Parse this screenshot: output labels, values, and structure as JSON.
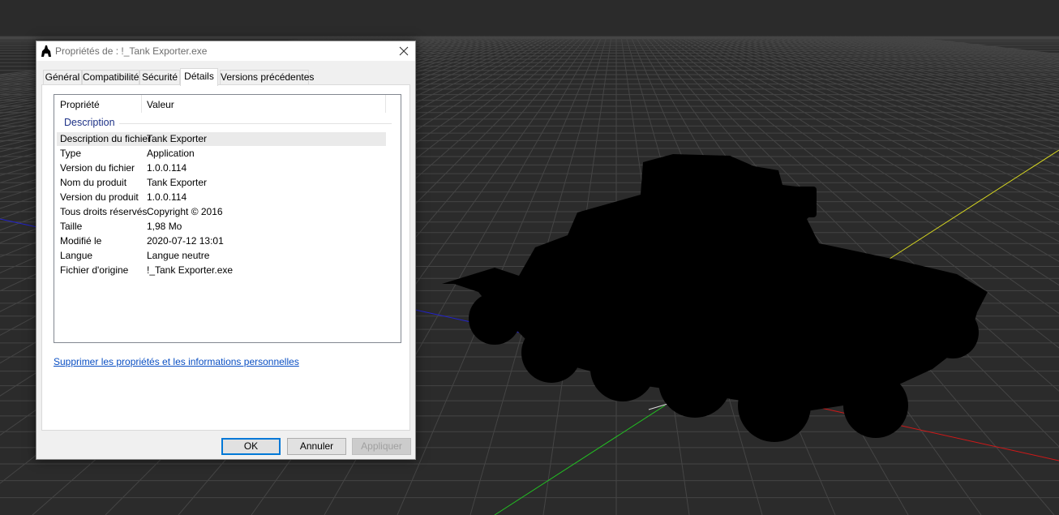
{
  "dialog": {
    "title": "Propriétés de : !_Tank Exporter.exe",
    "tabs": [
      {
        "label": "Général"
      },
      {
        "label": "Compatibilité"
      },
      {
        "label": "Sécurité"
      },
      {
        "label": "Détails"
      },
      {
        "label": "Versions précédentes"
      }
    ],
    "active_tab": "Détails",
    "columns": {
      "property": "Propriété",
      "value": "Valeur"
    },
    "group": "Description",
    "rows": [
      {
        "key": "Description du fichier",
        "value": "Tank Exporter"
      },
      {
        "key": "Type",
        "value": "Application"
      },
      {
        "key": "Version du fichier",
        "value": "1.0.0.114"
      },
      {
        "key": "Nom du produit",
        "value": "Tank Exporter"
      },
      {
        "key": "Version du produit",
        "value": "1.0.0.114"
      },
      {
        "key": "Tous droits réservés",
        "value": "Copyright ©  2016"
      },
      {
        "key": "Taille",
        "value": "1,98 Mo"
      },
      {
        "key": "Modifié le",
        "value": "2020-07-12 13:01"
      },
      {
        "key": "Langue",
        "value": "Langue neutre"
      },
      {
        "key": "Fichier d'origine",
        "value": "!_Tank Exporter.exe"
      }
    ],
    "privacy_link": "Supprimer les propriétés et les informations personnelles",
    "buttons": {
      "ok": "OK",
      "cancel": "Annuler",
      "apply": "Appliquer"
    }
  },
  "colors": {
    "viewport_background": "#2b2b2b",
    "grid_line": "#4a4a4a",
    "axis_x": "#d01818",
    "axis_y": "#d8d820",
    "axis_z": "#2222cc",
    "axis_green": "#22c222",
    "link": "#0a4fc3",
    "group_label": "#1e3287"
  },
  "icons": {
    "app": "tank-silhouette-icon",
    "close": "close-icon"
  }
}
